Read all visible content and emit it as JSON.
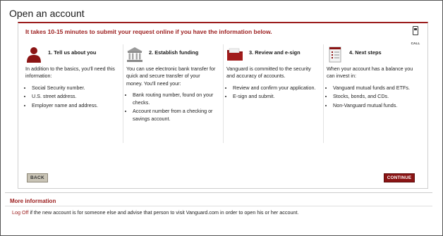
{
  "page": {
    "title": "Open an account"
  },
  "intro": "It takes 10-15 minutes to submit your request online if you have the information below.",
  "call": {
    "label": "CALL",
    "icon": "phone-icon"
  },
  "steps": [
    {
      "title": "1.  Tell us about you",
      "icon": "person-icon",
      "text": "In addition to the basics, you'll need this information:",
      "items": [
        "Social Security number.",
        "U.S. street address.",
        "Employer name and address."
      ]
    },
    {
      "title": "2.  Establish funding",
      "icon": "bank-icon",
      "text": "You can use electronic bank transfer for quick and secure transfer of your money. You'll need your:",
      "items": [
        "Bank routing number, found on your checks.",
        "Account number from a checking or savings account."
      ]
    },
    {
      "title": "3.  Review and e-sign",
      "icon": "folder-icon",
      "text": "Vanguard is committed to the security and accuracy of accounts.",
      "items": [
        "Review and confirm your application.",
        "E-sign and submit."
      ]
    },
    {
      "title": "4.  Next steps",
      "icon": "checklist-icon",
      "text": "When your account has a balance you can invest in:",
      "items": [
        "Vanguard mutual funds and ETFs.",
        "Stocks, bonds, and CDs.",
        "Non-Vanguard mutual funds."
      ]
    }
  ],
  "buttons": {
    "back": "BACK",
    "continue": "CONTINUE"
  },
  "more_info": {
    "title": "More information",
    "link": "Log Off",
    "text": " if the new account is for someone else and advise that person to visit Vanguard.com in order to open his or her account."
  },
  "colors": {
    "brand": "#9b1c1c",
    "continue_bg": "#8b1414",
    "back_bg": "#c9c4b6"
  }
}
